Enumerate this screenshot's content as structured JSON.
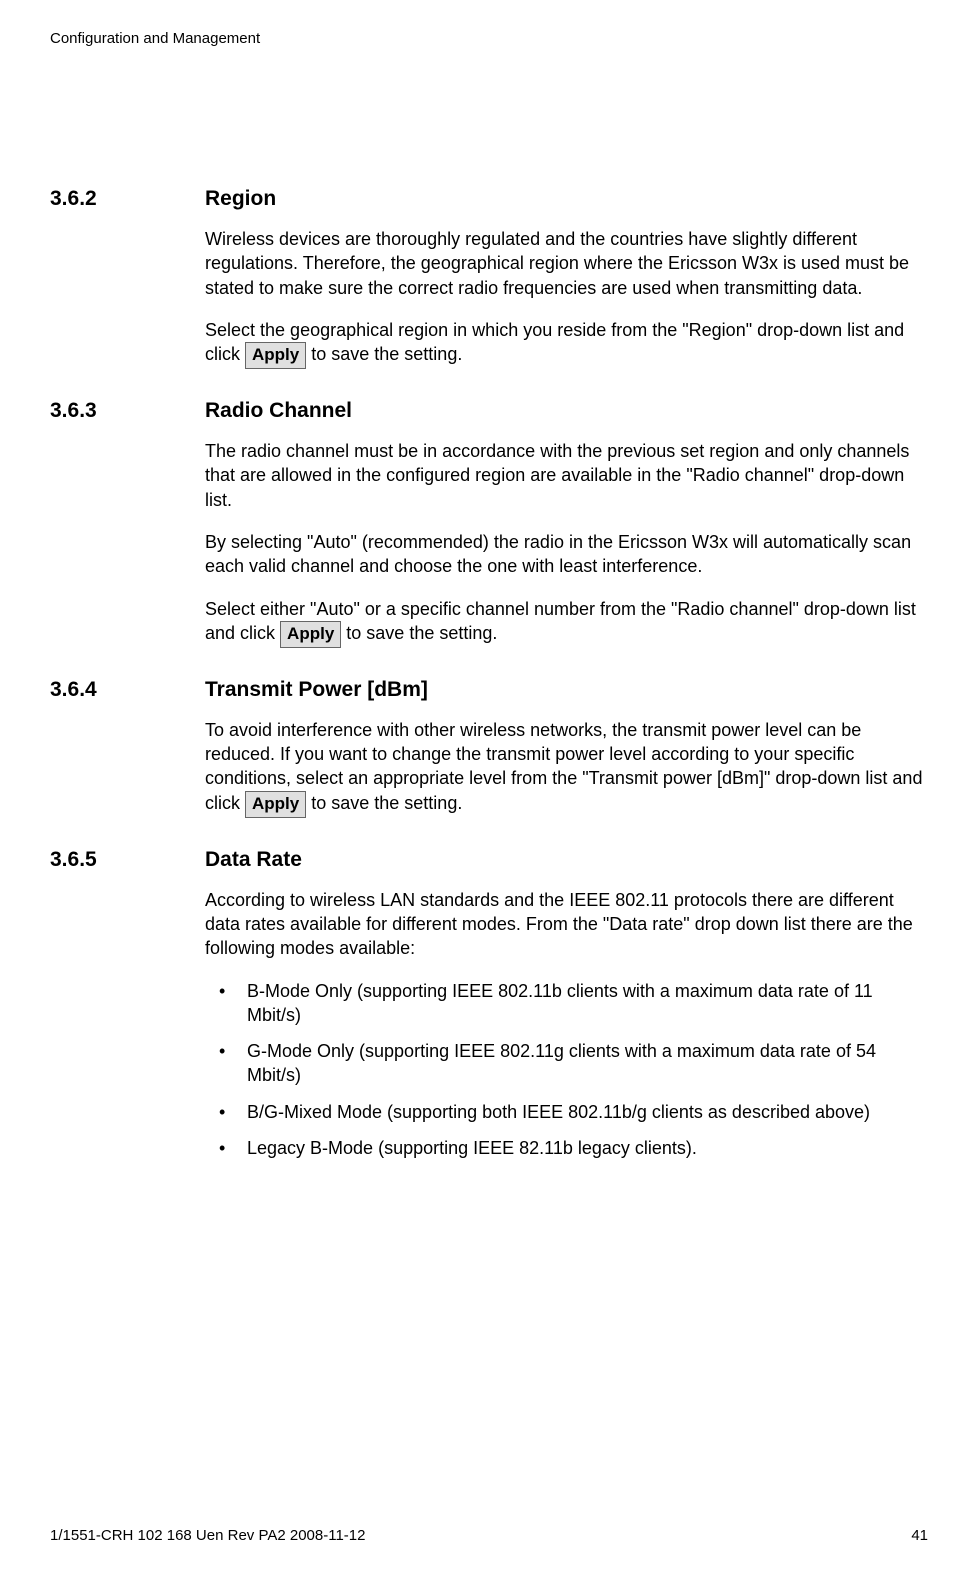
{
  "header": "Configuration and Management",
  "sections": [
    {
      "number": "3.6.2",
      "title": "Region",
      "paras": [
        {
          "text": "Wireless devices are thoroughly regulated and the countries have slightly different regulations. Therefore, the geographical region where the Ericsson W3x is used must be stated to make sure the correct radio frequencies are used when transmitting data."
        },
        {
          "pre": "Select the geographical region in which you reside from the \"Region\" drop-down list and click ",
          "btn": "Apply",
          "post": " to save the setting."
        }
      ]
    },
    {
      "number": "3.6.3",
      "title": "Radio Channel",
      "paras": [
        {
          "text": "The radio channel must be in accordance with the previous set region and only channels that are allowed in the configured region are available in the \"Radio channel\" drop-down list."
        },
        {
          "text": "By selecting \"Auto\" (recommended) the radio in the Ericsson W3x will automatically scan each valid channel and choose the one with least interference."
        },
        {
          "pre": "Select either \"Auto\" or a specific channel number from the \"Radio channel\" drop-down list and click ",
          "btn": "Apply",
          "post": " to save the setting."
        }
      ]
    },
    {
      "number": "3.6.4",
      "title": "Transmit Power [dBm]",
      "paras": [
        {
          "pre": "To avoid interference with other wireless networks, the transmit power level can be reduced. If you want to change the transmit power level according to your specific conditions, select an appropriate level from the \"Transmit power [dBm]\" drop-down list and click ",
          "btn": "Apply",
          "post": " to save the setting."
        }
      ]
    },
    {
      "number": "3.6.5",
      "title": "Data Rate",
      "paras": [
        {
          "text": "According to wireless LAN standards and the IEEE 802.11 protocols there are different data rates available for different modes. From the \"Data rate\" drop down list there are the following modes available:"
        }
      ],
      "bullets": [
        "B-Mode Only (supporting IEEE 802.11b clients with a maximum data rate of 11 Mbit/s)",
        "G-Mode Only (supporting IEEE 802.11g clients with a maximum data rate of 54 Mbit/s)",
        "B/G-Mixed Mode (supporting both IEEE 802.11b/g clients as described above)",
        "Legacy B-Mode (supporting IEEE 82.11b legacy clients)."
      ]
    }
  ],
  "footer": {
    "left": "1/1551-CRH 102 168 Uen Rev PA2  2008-11-12",
    "right": "41"
  }
}
